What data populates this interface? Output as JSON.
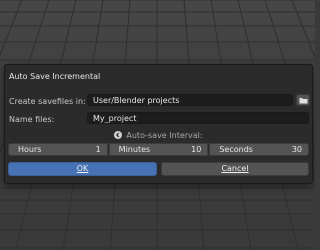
{
  "dialog": {
    "title": "Auto Save Incremental",
    "savefiles_label": "Create savefiles in:",
    "savefiles_value": "User/Blender projects",
    "name_label": "Name files:",
    "name_value": "My_project",
    "interval_label": "Auto-save Interval:",
    "spinners": [
      {
        "label": "Hours",
        "value": "1"
      },
      {
        "label": "Minutes",
        "value": "10"
      },
      {
        "label": "Seconds",
        "value": "30"
      }
    ],
    "ok_label": "OK",
    "cancel_label": "Cancel"
  },
  "icons": {
    "folder": "folder-icon",
    "info": "info-icon"
  },
  "colors": {
    "accent": "#4772b3",
    "dialog_bg": "#2b2b2b",
    "field_bg": "#1d1d1d",
    "button_bg": "#545454"
  }
}
